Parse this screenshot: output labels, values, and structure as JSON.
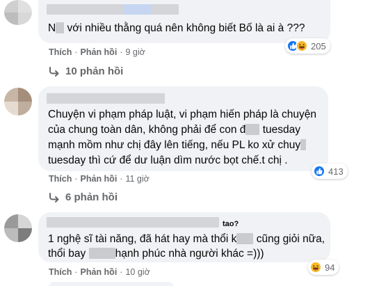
{
  "colors": {
    "accent_blue": "#1877f2",
    "haha_yellow": "#f7b928",
    "bubble_bg": "#f0f2f5",
    "meta_gray": "#65676b"
  },
  "comments": [
    {
      "lines": [
        "N",
        "với nhiều thằng quá nên không biết Bố là ai à ???"
      ],
      "actions": {
        "like": "Thích",
        "reply": "Phản hồi",
        "time": "9 giờ"
      },
      "reactions": {
        "icons": [
          "like-icon",
          "haha-icon"
        ],
        "count": "205"
      },
      "replies_label": "10 phản hồi"
    },
    {
      "lines": [
        "Chuyện vi phạm pháp luật, vi phạm hiến pháp là chuyện",
        "của chung toàn dân, không phải để con đ",
        "tuesday",
        "mạnh mồm như chị đây lên tiếng, nếu PL ko xử chuy",
        "tuesday thì cứ để dư luận dìm nước bọt chế.t chị ."
      ],
      "actions": {
        "like": "Thích",
        "reply": "Phản hồi",
        "time": "11 giờ"
      },
      "reactions": {
        "icons": [
          "like-icon"
        ],
        "count": "413"
      },
      "replies_label": "6 phản hồi"
    },
    {
      "name_suffix": "tao?",
      "lines": [
        "1 nghệ sĩ tài năng, đã hát hay mà thổi k",
        "cũng giỏi nữa,",
        "thổi bay",
        "hạnh phúc nhà người khác =)))"
      ],
      "actions": {
        "like": "Thích",
        "reply": "Phản hồi",
        "time": "10 giờ"
      },
      "reactions": {
        "icons": [
          "haha-icon"
        ],
        "count": "94"
      }
    }
  ]
}
